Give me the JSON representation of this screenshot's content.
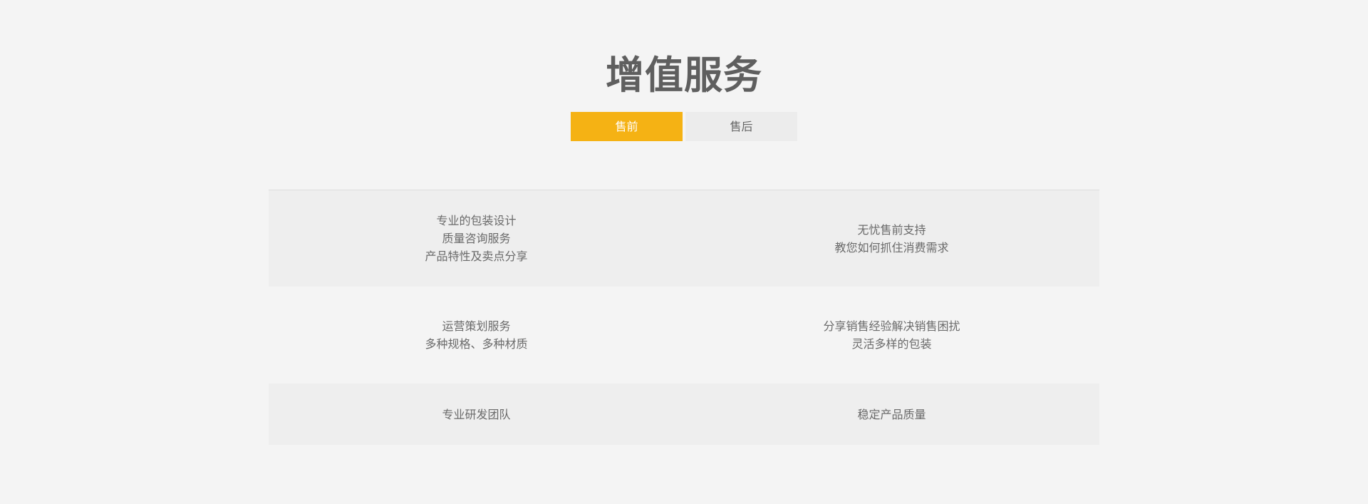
{
  "header": {
    "title": "增值服务"
  },
  "tabs": [
    {
      "label": "售前",
      "active": true
    },
    {
      "label": "售后",
      "active": false
    }
  ],
  "colors": {
    "accent": "#f5b214",
    "background": "#f4f4f4",
    "row_shade": "#eeeeee",
    "text": "#666666"
  },
  "table": {
    "rows": [
      {
        "left": [
          "专业的包装设计",
          "质量咨询服务",
          "产品特性及卖点分享"
        ],
        "right": [
          "无忧售前支持",
          "教您如何抓住消费需求"
        ]
      },
      {
        "left": [
          "运营策划服务",
          "多种规格、多种材质"
        ],
        "right": [
          "分享销售经验解决销售困扰",
          "灵活多样的包装"
        ]
      },
      {
        "left": [
          "专业研发团队"
        ],
        "right": [
          "稳定产品质量"
        ]
      }
    ]
  }
}
